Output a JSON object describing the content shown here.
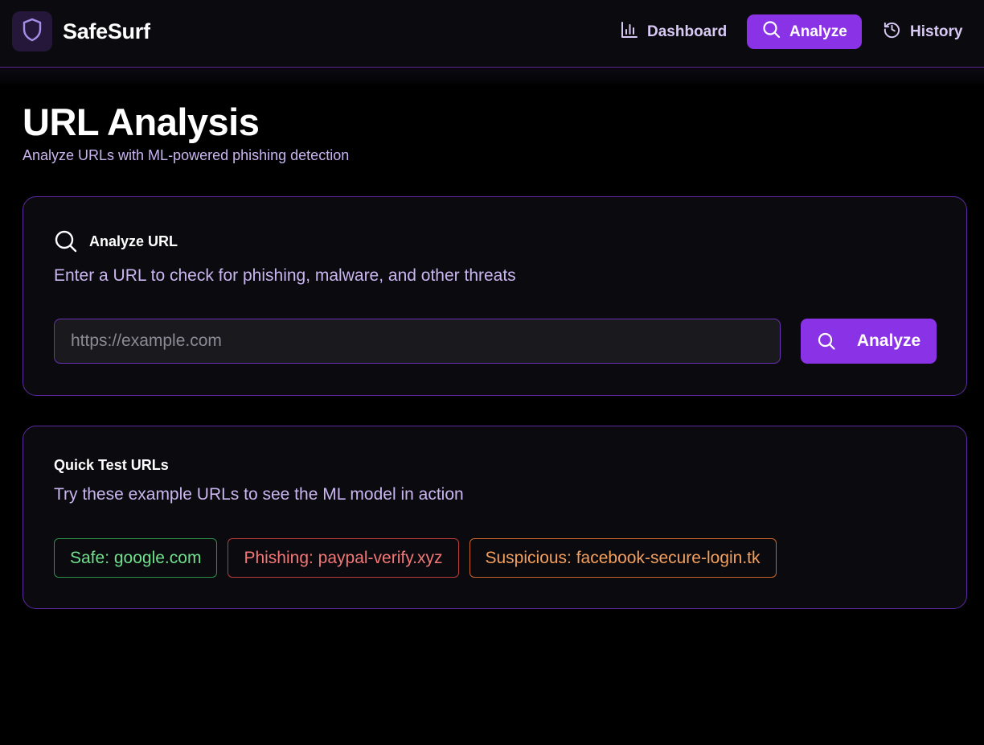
{
  "app": {
    "brand_name": "SafeSurf",
    "logo_icon": "shield-icon"
  },
  "nav": {
    "items": [
      {
        "label": "Dashboard",
        "icon": "bar-chart-icon",
        "active": false
      },
      {
        "label": "Analyze",
        "icon": "search-icon",
        "active": true
      },
      {
        "label": "History",
        "icon": "history-icon",
        "active": false
      }
    ]
  },
  "page": {
    "title": "URL Analysis",
    "subtitle": "Analyze URLs with ML-powered phishing detection"
  },
  "analyze_card": {
    "title": "Analyze URL",
    "icon": "search-icon",
    "description": "Enter a URL to check for phishing, malware, and other threats",
    "input_value": "",
    "input_placeholder": "https://example.com",
    "button_label": "Analyze"
  },
  "quick_card": {
    "title": "Quick Test URLs",
    "description": "Try these example URLs to see the ML model in action",
    "chips": [
      {
        "label": "Safe: google.com",
        "status": "safe",
        "color": "#6fe08c"
      },
      {
        "label": "Phishing: paypal-verify.xyz",
        "status": "phishing",
        "color": "#f47777"
      },
      {
        "label": "Suspicious: facebook-secure-login.tk",
        "status": "suspicious",
        "color": "#f3a05d"
      }
    ]
  },
  "colors": {
    "accent": "#8a32e6",
    "border": "#5b2aa0",
    "muted_text": "#c9b5f0",
    "background": "#000000",
    "card_background": "#0b0a0e"
  }
}
